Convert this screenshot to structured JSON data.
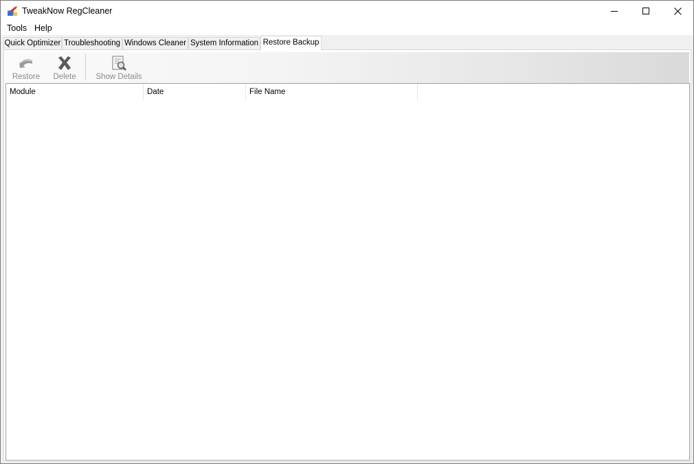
{
  "window": {
    "title": "TweakNow RegCleaner"
  },
  "titlebar": {
    "app_icon": "regcleaner-app-icon",
    "controls": [
      "minimize-icon",
      "maximize-icon",
      "close-icon"
    ]
  },
  "menu": {
    "items": [
      {
        "label": "Tools"
      },
      {
        "label": "Help"
      }
    ]
  },
  "tabs": [
    {
      "label": "Quick Optimizer",
      "active": false
    },
    {
      "label": "Troubleshooting",
      "active": false
    },
    {
      "label": "Windows Cleaner",
      "active": false
    },
    {
      "label": "System Information",
      "active": false
    },
    {
      "label": "Restore Backup",
      "active": true
    }
  ],
  "toolbar": {
    "buttons": [
      {
        "label": "Restore",
        "icon": "restore-arrow-icon",
        "enabled": false
      },
      {
        "label": "Delete",
        "icon": "delete-x-icon",
        "enabled": false
      },
      {
        "label": "Show Details",
        "icon": "document-magnifier-icon",
        "enabled": false
      }
    ]
  },
  "list": {
    "columns": [
      {
        "label": "Module"
      },
      {
        "label": "Date"
      },
      {
        "label": "File Name"
      }
    ],
    "rows": []
  },
  "colors": {
    "window_border": "#7a7a7a",
    "chrome_bg": "#f0f0f0",
    "disabled_text": "#8a8a8a"
  }
}
